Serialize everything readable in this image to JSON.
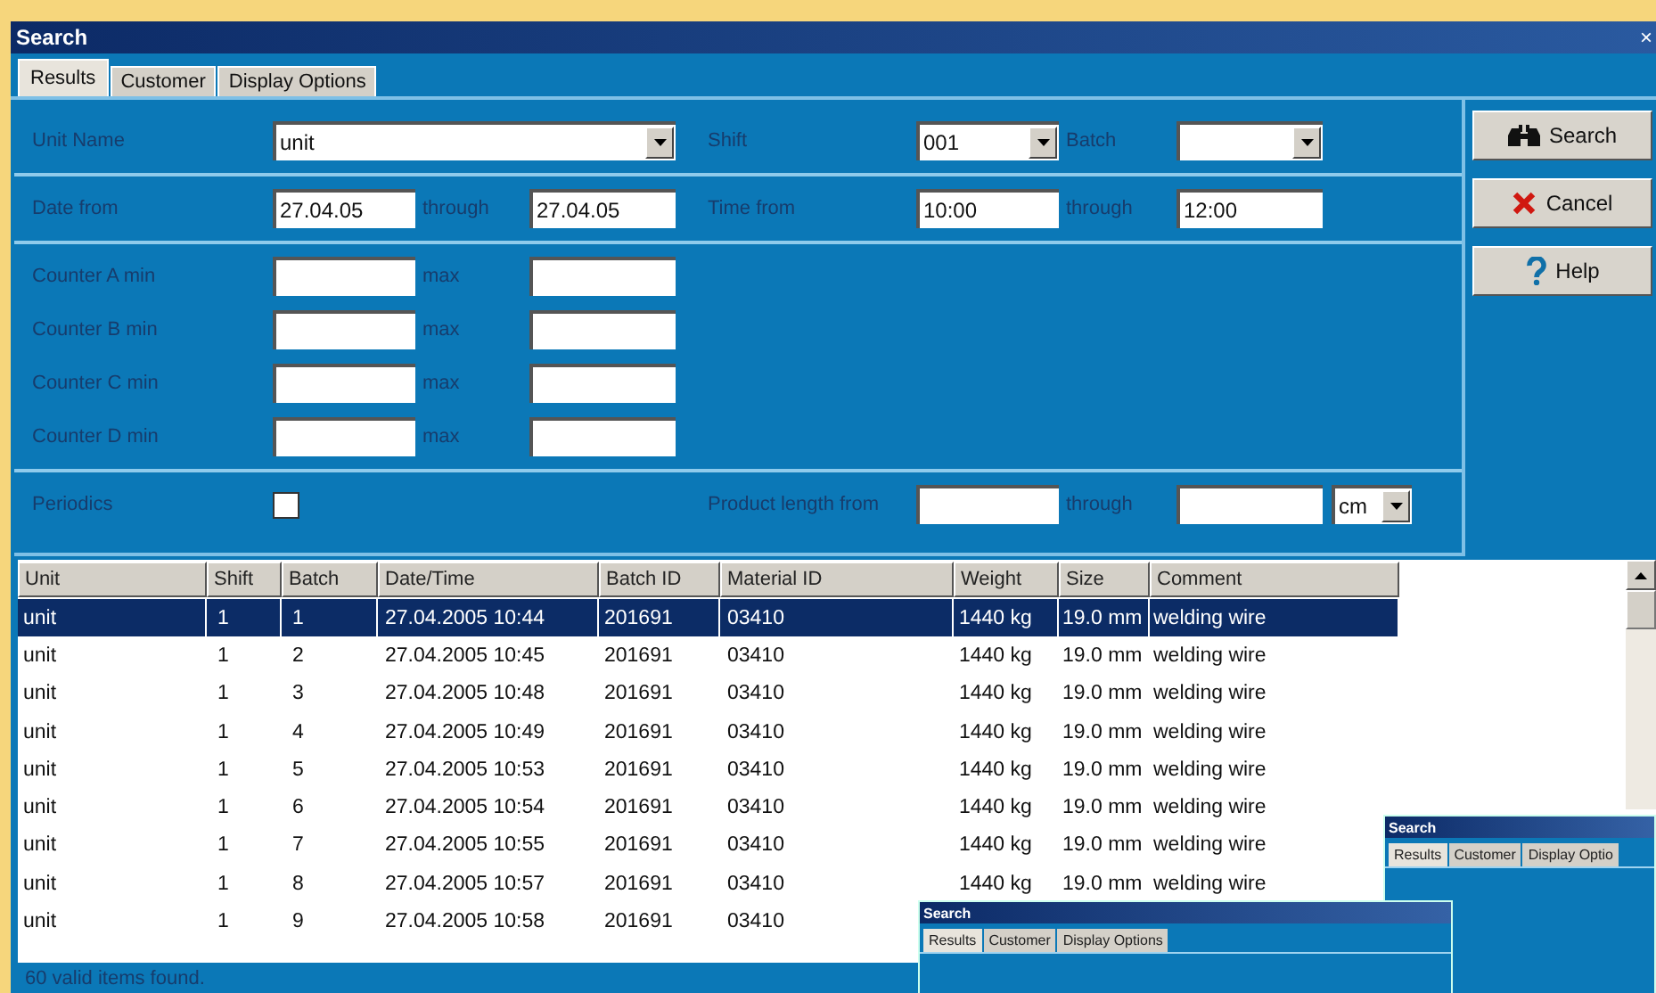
{
  "window": {
    "title": "Search",
    "close": "×"
  },
  "tabs": [
    {
      "label": "Results",
      "selected": true
    },
    {
      "label": "Customer",
      "selected": false
    },
    {
      "label": "Display Options",
      "selected": false
    }
  ],
  "form": {
    "unit_name": {
      "label": "Unit Name",
      "value": "unit"
    },
    "shift": {
      "label": "Shift",
      "value": "001"
    },
    "batch": {
      "label": "Batch"
    },
    "date": {
      "label": "Date from",
      "from": "27.04.05",
      "through_label": "through",
      "to": "27.04.05"
    },
    "time": {
      "label": "Time from",
      "from": "10:00",
      "through_label": "through",
      "to": "12:00"
    },
    "counters": [
      {
        "label": "Counter A min",
        "max_label": "max"
      },
      {
        "label": "Counter B min",
        "max_label": "max"
      },
      {
        "label": "Counter C min",
        "max_label": "max"
      },
      {
        "label": "Counter D min",
        "max_label": "max"
      }
    ],
    "periodics": {
      "label": "Periodics",
      "checked": false
    },
    "product_length": {
      "label": "Product length from",
      "through_label": "through",
      "unit": "cm"
    }
  },
  "buttons": [
    {
      "kind": "search",
      "label": "Search"
    },
    {
      "kind": "cancel",
      "label": "Cancel"
    },
    {
      "kind": "help",
      "label": "Help"
    }
  ],
  "table": {
    "columns": [
      "Unit",
      "Shift",
      "Batch",
      "Date/Time",
      "Batch ID",
      "Material ID",
      "Weight",
      "Size",
      "Comment"
    ],
    "rows": [
      {
        "selected": true,
        "cells": [
          "unit",
          "1",
          "1",
          "27.04.2005 10:44",
          "201691",
          "03410",
          "1440 kg",
          "19.0 mm",
          "welding wire"
        ]
      },
      {
        "selected": false,
        "cells": [
          "unit",
          "1",
          "2",
          "27.04.2005 10:45",
          "201691",
          "03410",
          "1440 kg",
          "19.0 mm",
          "welding wire"
        ]
      },
      {
        "selected": false,
        "cells": [
          "unit",
          "1",
          "3",
          "27.04.2005 10:48",
          "201691",
          "03410",
          "1440 kg",
          "19.0 mm",
          "welding wire"
        ]
      },
      {
        "selected": false,
        "cells": [
          "unit",
          "1",
          "4",
          "27.04.2005 10:49",
          "201691",
          "03410",
          "1440 kg",
          "19.0 mm",
          "welding wire"
        ]
      },
      {
        "selected": false,
        "cells": [
          "unit",
          "1",
          "5",
          "27.04.2005 10:53",
          "201691",
          "03410",
          "1440 kg",
          "19.0 mm",
          "welding wire"
        ]
      },
      {
        "selected": false,
        "cells": [
          "unit",
          "1",
          "6",
          "27.04.2005 10:54",
          "201691",
          "03410",
          "1440 kg",
          "19.0 mm",
          "welding wire"
        ]
      },
      {
        "selected": false,
        "cells": [
          "unit",
          "1",
          "7",
          "27.04.2005 10:55",
          "201691",
          "03410",
          "1440 kg",
          "19.0 mm",
          "welding wire"
        ]
      },
      {
        "selected": false,
        "cells": [
          "unit",
          "1",
          "8",
          "27.04.2005 10:57",
          "201691",
          "03410",
          "1440 kg",
          "19.0 mm",
          "welding wire"
        ]
      },
      {
        "selected": false,
        "cells": [
          "unit",
          "1",
          "9",
          "27.04.2005 10:58",
          "201691",
          "03410"
        ]
      }
    ]
  },
  "status_bar": "60 valid items found.",
  "overlay_windows": [
    {
      "title": "Search",
      "tabs": [
        {
          "label": "Results",
          "selected": true
        },
        {
          "label": "Customer",
          "selected": false
        },
        {
          "label": "Display Optio",
          "selected": false
        }
      ]
    },
    {
      "title": "Search",
      "tabs": [
        {
          "label": "Results",
          "selected": true
        },
        {
          "label": "Customer",
          "selected": false
        },
        {
          "label": "Display Options",
          "selected": false
        }
      ]
    }
  ]
}
